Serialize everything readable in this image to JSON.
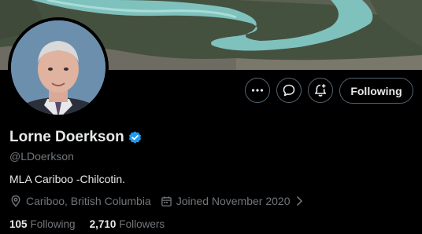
{
  "profile": {
    "name": "Lorne Doerkson",
    "handle": "@LDoerkson",
    "bio": "MLA Cariboo -Chilcotin.",
    "location": "Cariboo, British Columbia",
    "joined": "Joined November 2020",
    "verified": true
  },
  "stats": {
    "following_count": "105",
    "following_label": "Following",
    "followers_count": "2,710",
    "followers_label": "Followers"
  },
  "actions": {
    "follow_label": "Following",
    "more_icon": "more-icon",
    "message_icon": "message-icon",
    "notify_icon": "notification-bell-icon"
  },
  "colors": {
    "background": "#000000",
    "text_primary": "#e7e9ea",
    "text_secondary": "#71767b",
    "verified_badge": "#1d9bf0",
    "button_border": "#536471"
  }
}
